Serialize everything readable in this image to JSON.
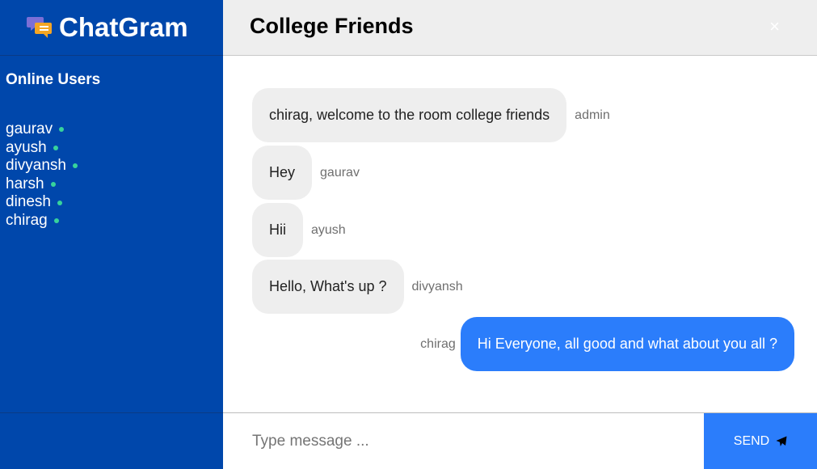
{
  "app": {
    "brand_name": "ChatGram",
    "brand_icon": "chat-bubbles-icon",
    "colors": {
      "sidebar": "#0047ab",
      "accent": "#2b7dfb",
      "online": "#37d39b"
    }
  },
  "sidebar": {
    "online_title": "Online Users",
    "users": [
      {
        "name": "gaurav"
      },
      {
        "name": "ayush"
      },
      {
        "name": "divyansh"
      },
      {
        "name": "harsh"
      },
      {
        "name": "dinesh"
      },
      {
        "name": "chirag"
      }
    ]
  },
  "header": {
    "room_title": "College Friends",
    "close_label": "×"
  },
  "messages": [
    {
      "text": "chirag, welcome to the room college friends",
      "sender": "admin",
      "own": false
    },
    {
      "text": "Hey",
      "sender": "gaurav",
      "own": false
    },
    {
      "text": "Hii",
      "sender": "ayush",
      "own": false
    },
    {
      "text": "Hello, What's up ?",
      "sender": "divyansh",
      "own": false
    },
    {
      "text": "Hi Everyone, all good and what about you all ?",
      "sender": "chirag",
      "own": true
    }
  ],
  "composer": {
    "placeholder": "Type message ...",
    "value": "",
    "send_label": "SEND",
    "send_icon": "paper-plane-icon"
  }
}
